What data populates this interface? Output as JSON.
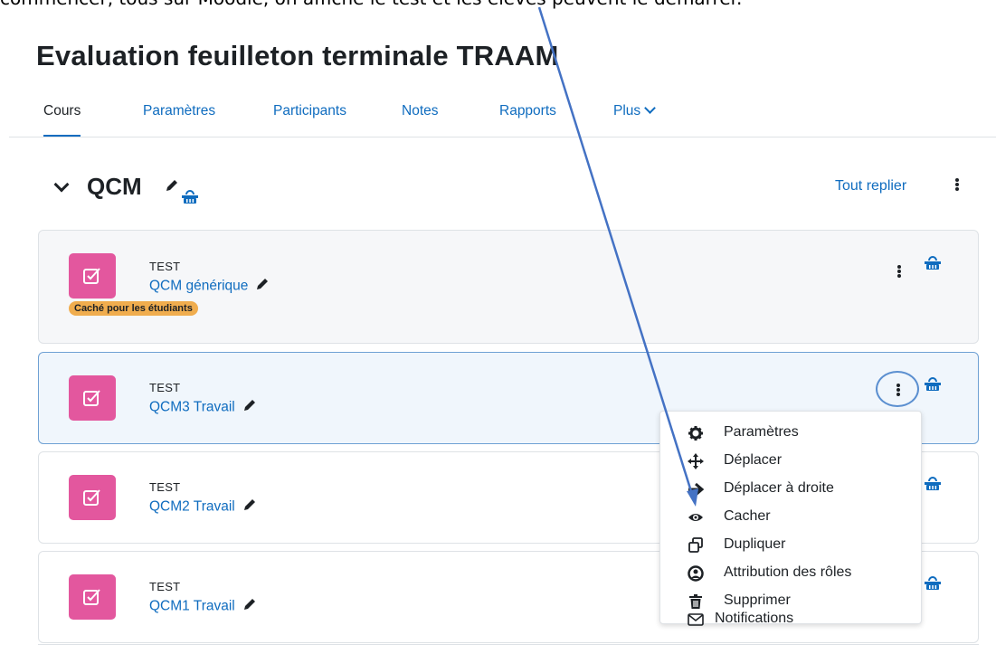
{
  "caption": "commencer, tous sur Moodle, on affiche le test et les élèves peuvent le démarrer.",
  "page_title": "Evaluation feuilleton terminale TRAAM",
  "nav": {
    "items": [
      {
        "label": "Cours",
        "active": true
      },
      {
        "label": "Paramètres"
      },
      {
        "label": "Participants"
      },
      {
        "label": "Notes"
      },
      {
        "label": "Rapports"
      },
      {
        "label": "Plus"
      }
    ]
  },
  "section": {
    "title": "QCM",
    "collapse_all": "Tout replier"
  },
  "activities": [
    {
      "type": "TEST",
      "name": "QCM générique",
      "badge": "Caché pour les étudiants"
    },
    {
      "type": "TEST",
      "name": "QCM3 Travail",
      "selected": true
    },
    {
      "type": "TEST",
      "name": "QCM2 Travail"
    },
    {
      "type": "TEST",
      "name": "QCM1 Travail"
    }
  ],
  "menu": {
    "items": [
      {
        "label": "Paramètres",
        "icon": "gear-icon"
      },
      {
        "label": "Déplacer",
        "icon": "move-icon"
      },
      {
        "label": "Déplacer à droite",
        "icon": "arrow-right-icon"
      },
      {
        "label": "Cacher",
        "icon": "eye-icon"
      },
      {
        "label": "Dupliquer",
        "icon": "duplicate-icon"
      },
      {
        "label": "Attribution des rôles",
        "icon": "user-circle-icon"
      },
      {
        "label": "Supprimer",
        "icon": "trash-icon"
      },
      {
        "label": "Notifications",
        "icon": "envelope-icon"
      }
    ]
  },
  "colors": {
    "link": "#0f6cbf",
    "activity_icon": "#e3579e",
    "badge": "#f0ad4e",
    "annotation_arrow": "#4472c4"
  }
}
